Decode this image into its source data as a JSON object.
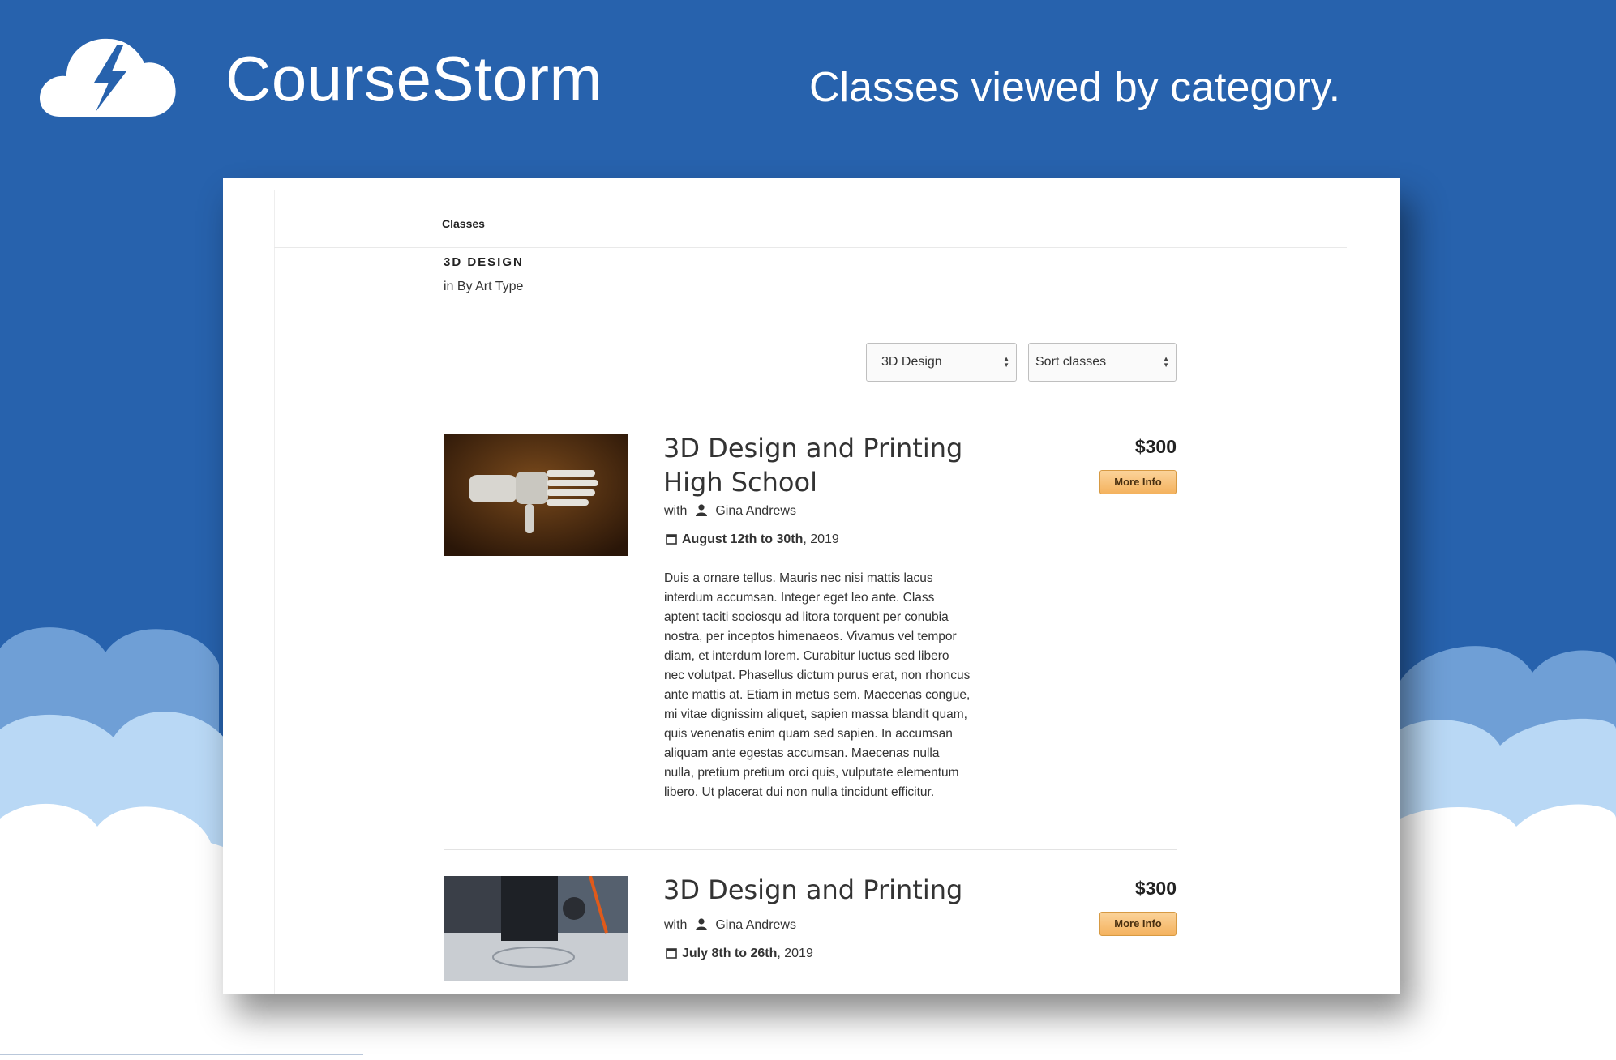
{
  "brand": {
    "name": "CourseStorm",
    "logo_icon": "cloud-lightning-icon"
  },
  "tagline": "Classes viewed by category.",
  "colors": {
    "background": "#2762ad",
    "button": "#f4b25e"
  },
  "page": {
    "breadcrumb": "Classes",
    "category_title": "3D DESIGN",
    "category_parent": "in By Art Type",
    "filters": {
      "category_select": "3D Design",
      "sort_select": "Sort classes"
    }
  },
  "courses": [
    {
      "title": "3D Design and Printing High School",
      "with_label": "with",
      "instructor": "Gina Andrews",
      "dates_bold": "August 12th to 30th",
      "dates_rest": ", 2019",
      "description": "Duis a ornare tellus. Mauris nec nisi mattis lacus interdum accumsan. Integer eget leo ante. Class aptent taciti sociosqu ad litora torquent per conubia nostra, per inceptos himenaeos. Vivamus vel tempor diam, et interdum lorem. Curabitur luctus sed libero nec volutpat. Phasellus dictum purus erat, non rhoncus ante mattis at. Etiam in metus sem. Maecenas congue, mi vitae dignissim aliquet, sapien massa blandit quam, quis venenatis enim quam sed sapien. In accumsan aliquam ante egestas accumsan. Maecenas nulla nulla, pretium pretium orci quis, vulputate elementum libero. Ut placerat dui non nulla tincidunt efficitur.",
      "price": "$300",
      "button": "More Info",
      "image_icon": "robotic-hand-photo"
    },
    {
      "title": "3D Design and Printing",
      "with_label": "with",
      "instructor": "Gina Andrews",
      "dates_bold": "July 8th to 26th",
      "dates_rest": ", 2019",
      "price": "$300",
      "button": "More Info",
      "image_icon": "3d-printer-photo"
    }
  ]
}
